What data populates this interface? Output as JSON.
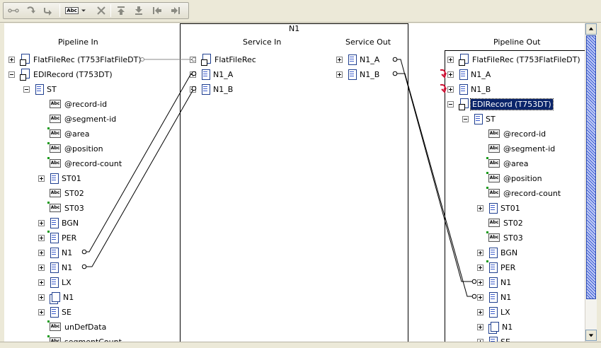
{
  "toolbar": {
    "buttons": [
      {
        "name": "link-icon"
      },
      {
        "name": "step-over-icon"
      },
      {
        "name": "step-into-icon"
      },
      {
        "name": "set-value-icon",
        "label": "Abc"
      },
      {
        "name": "delete-link-icon"
      },
      {
        "name": "shift-up-icon"
      },
      {
        "name": "shift-down-icon"
      },
      {
        "name": "shift-left-icon"
      },
      {
        "name": "shift-right-icon"
      }
    ]
  },
  "columns": {
    "pipeline_in": "Pipeline In",
    "service_name": "N1",
    "service_in": "Service In",
    "service_out": "Service Out",
    "pipeline_out": "Pipeline Out"
  },
  "pipeline_in": [
    {
      "label": "FlatFileRec (T753FlatFileDT)",
      "icon": "rec",
      "exp": "plus"
    },
    {
      "label": "EDIRecord (T753DT)",
      "icon": "rec",
      "exp": "minus"
    },
    {
      "label": "ST",
      "icon": "doc",
      "exp": "minus"
    },
    {
      "label": "@record-id",
      "icon": "str"
    },
    {
      "label": "@segment-id",
      "icon": "str"
    },
    {
      "label": "@area",
      "icon": "str-opt"
    },
    {
      "label": "@position",
      "icon": "str-opt"
    },
    {
      "label": "@record-count",
      "icon": "str-opt"
    },
    {
      "label": "ST01",
      "icon": "doc",
      "exp": "plus"
    },
    {
      "label": "ST02",
      "icon": "str"
    },
    {
      "label": "ST03",
      "icon": "str-opt"
    },
    {
      "label": "BGN",
      "icon": "doc",
      "exp": "plus"
    },
    {
      "label": "PER",
      "icon": "doc-opt",
      "exp": "plus"
    },
    {
      "label": "N1",
      "icon": "doc",
      "exp": "plus"
    },
    {
      "label": "N1",
      "icon": "doc",
      "exp": "plus"
    },
    {
      "label": "LX",
      "icon": "doc",
      "exp": "plus"
    },
    {
      "label": "N1",
      "icon": "list",
      "exp": "plus"
    },
    {
      "label": "SE",
      "icon": "doc",
      "exp": "plus"
    },
    {
      "label": "unDefData",
      "icon": "str-opt"
    },
    {
      "label": "segmentCount",
      "icon": "str-opt"
    }
  ],
  "service_in": [
    {
      "label": "FlatFileRec",
      "icon": "rec",
      "exp": "plus"
    },
    {
      "label": "N1_A",
      "icon": "doc",
      "exp": "plus"
    },
    {
      "label": "N1_B",
      "icon": "doc",
      "exp": "plus"
    }
  ],
  "service_out": [
    {
      "label": "N1_A",
      "icon": "doc",
      "exp": "plus"
    },
    {
      "label": "N1_B",
      "icon": "doc",
      "exp": "plus"
    }
  ],
  "pipeline_out": [
    {
      "label": "FlatFileRec (T753FlatFileDT)",
      "icon": "rec",
      "exp": "plus"
    },
    {
      "label": "N1_A",
      "icon": "doc",
      "exp": "plus",
      "dropped": true
    },
    {
      "label": "N1_B",
      "icon": "doc",
      "exp": "plus",
      "dropped": true
    },
    {
      "label": "EDIRecord (T753DT)",
      "icon": "rec",
      "exp": "minus",
      "selected": true
    },
    {
      "label": "ST",
      "icon": "doc",
      "exp": "minus"
    },
    {
      "label": "@record-id",
      "icon": "str"
    },
    {
      "label": "@segment-id",
      "icon": "str"
    },
    {
      "label": "@area",
      "icon": "str-opt"
    },
    {
      "label": "@position",
      "icon": "str-opt"
    },
    {
      "label": "@record-count",
      "icon": "str-opt"
    },
    {
      "label": "ST01",
      "icon": "doc",
      "exp": "plus"
    },
    {
      "label": "ST02",
      "icon": "str"
    },
    {
      "label": "ST03",
      "icon": "str-opt"
    },
    {
      "label": "BGN",
      "icon": "doc",
      "exp": "plus"
    },
    {
      "label": "PER",
      "icon": "doc-opt",
      "exp": "plus"
    },
    {
      "label": "N1",
      "icon": "doc",
      "exp": "plus"
    },
    {
      "label": "N1",
      "icon": "doc",
      "exp": "plus"
    },
    {
      "label": "LX",
      "icon": "doc",
      "exp": "plus"
    },
    {
      "label": "N1",
      "icon": "list",
      "exp": "plus"
    },
    {
      "label": "SE",
      "icon": "doc",
      "exp": "plus"
    }
  ],
  "colors": {
    "selection": "#0a246a",
    "link": "#000000",
    "drop_arrow": "#cc1133"
  }
}
